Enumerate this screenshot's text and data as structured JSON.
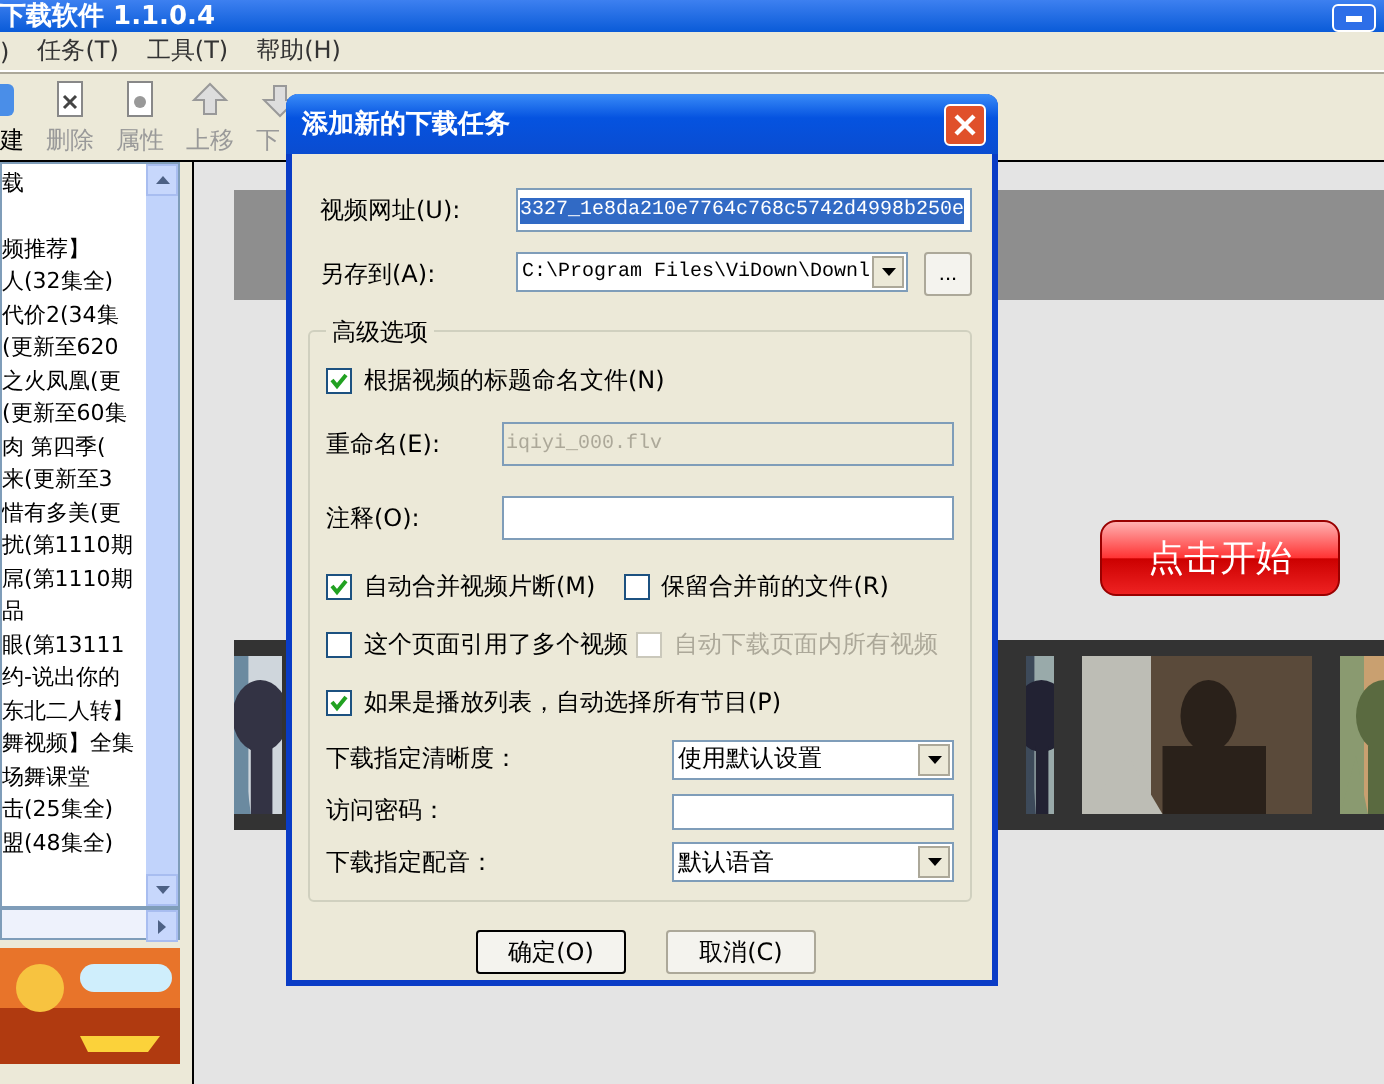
{
  "app_title": "下载软件 1.1.0.4",
  "menu": [
    ")",
    "任务(T)",
    "工具(T)",
    "帮助(H)"
  ],
  "toolbar": [
    {
      "label": "建",
      "disabled": false
    },
    {
      "label": "删除",
      "disabled": true
    },
    {
      "label": "属性",
      "disabled": true
    },
    {
      "label": "上移",
      "disabled": true
    },
    {
      "label": "下",
      "disabled": true
    }
  ],
  "sidebar": {
    "items": [
      "载",
      "频推荐】",
      "人(32集全)",
      "代价2(34集",
      "(更新至620",
      "之火凤凰(更",
      "(更新至60集",
      "肉 第四季(",
      "来(更新至3",
      "惜有多美(更",
      "扰(第1110期",
      "屌(第1110期",
      "品",
      "眼(第13111",
      "约-说出你的",
      "东北二人转】",
      "舞视频】全集",
      "场舞课堂",
      "击(25集全)",
      "盟(48集全)"
    ]
  },
  "player": {
    "start_button": "点击开始"
  },
  "dialog": {
    "title": "添加新的下载任务",
    "url": {
      "label": "视频网址(U):",
      "value": "3327_1e8da210e7764c768c5742d4998b250e",
      "selected": true
    },
    "save_to": {
      "label": "另存到(A):",
      "value": "C:\\Program Files\\ViDown\\Downl",
      "browse": "..."
    },
    "group": "高级选项",
    "rename_by_title": {
      "label": "根据视频的标题命名文件(N)",
      "checked": true,
      "disabled": false
    },
    "rename": {
      "label": "重命名(E):",
      "value": "iqiyi_000.flv",
      "disabled": true
    },
    "note": {
      "label": "注释(O):"
    },
    "options": [
      {
        "label": "自动合并视频片断(M)",
        "checked": true,
        "disabled": false
      },
      {
        "label": "保留合并前的文件(R)",
        "checked": false,
        "disabled": false
      },
      {
        "label": "这个页面引用了多个视频",
        "checked": false,
        "disabled": false
      },
      {
        "label": "自动下载页面内所有视频",
        "checked": false,
        "disabled": true
      },
      {
        "label": "如果是播放列表，自动选择所有节目(P)",
        "checked": true,
        "disabled": false
      }
    ],
    "quality": {
      "label": "下载指定清晰度：",
      "value": "使用默认设置"
    },
    "password": {
      "label": "访问密码："
    },
    "dub": {
      "label": "下载指定配音：",
      "value": "默认语音"
    },
    "buttons": [
      {
        "label": "确定(O)",
        "default": true
      },
      {
        "label": "取消(C)",
        "default": false
      }
    ]
  }
}
